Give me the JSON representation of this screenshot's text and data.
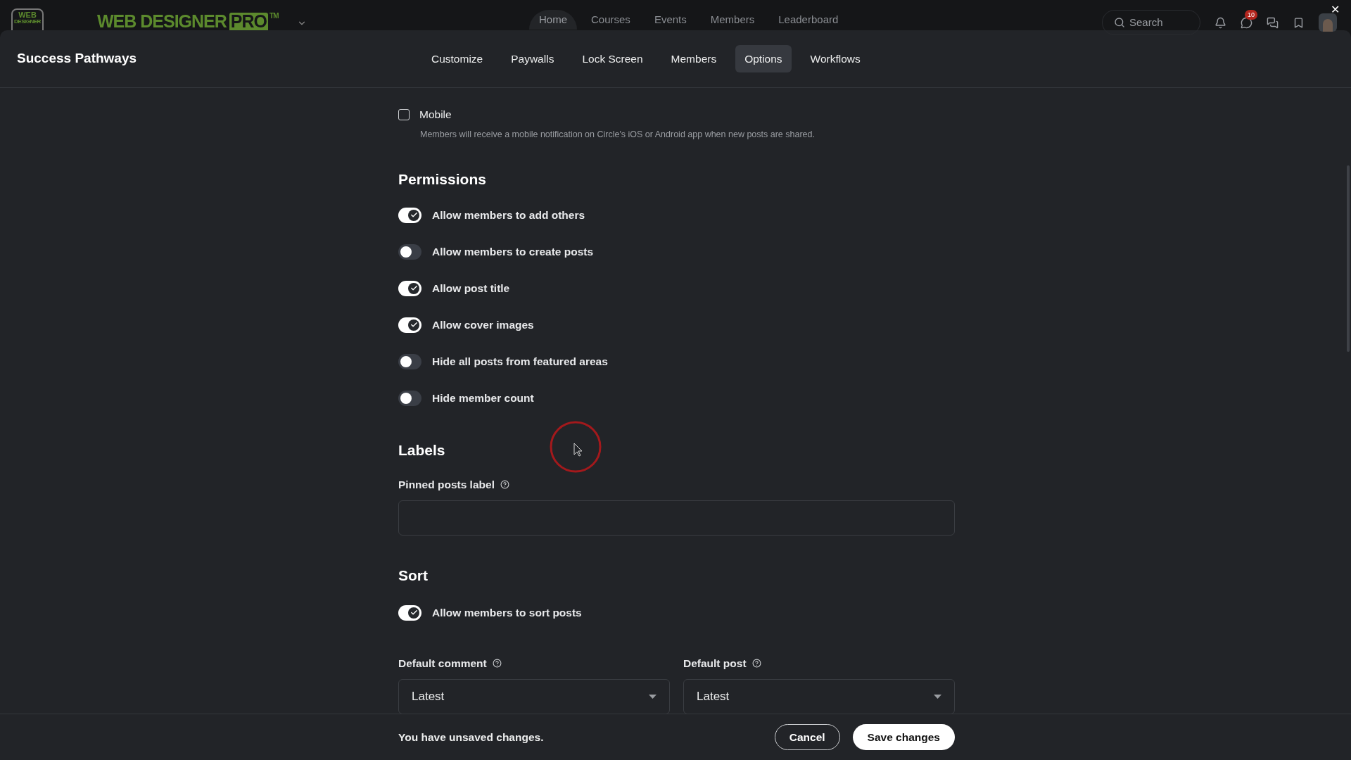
{
  "topbar": {
    "logo_badge": [
      "WEB",
      "DESIGNER"
    ],
    "brand": {
      "name": "WEB DESIGNER",
      "highlight": "PRO",
      "mark": "TM"
    },
    "nav": [
      {
        "label": "Home",
        "selected": true
      },
      {
        "label": "Courses",
        "selected": false
      },
      {
        "label": "Events",
        "selected": false
      },
      {
        "label": "Members",
        "selected": false
      },
      {
        "label": "Leaderboard",
        "selected": false
      }
    ],
    "search": {
      "placeholder": "Search"
    },
    "chat_badge": "10",
    "close": "✕"
  },
  "modal": {
    "title": "Success Pathways",
    "tabs": [
      {
        "label": "Customize",
        "selected": false
      },
      {
        "label": "Paywalls",
        "selected": false
      },
      {
        "label": "Lock Screen",
        "selected": false
      },
      {
        "label": "Members",
        "selected": false
      },
      {
        "label": "Options",
        "selected": true
      },
      {
        "label": "Workflows",
        "selected": false
      }
    ],
    "mobile": {
      "label": "Mobile",
      "checked": false,
      "description": "Members will receive a mobile notification on Circle's iOS or Android app when new posts are shared."
    },
    "permissions": {
      "heading": "Permissions",
      "toggles": [
        {
          "label": "Allow members to add others",
          "on": true
        },
        {
          "label": "Allow members to create posts",
          "on": false
        },
        {
          "label": "Allow post title",
          "on": true
        },
        {
          "label": "Allow cover images",
          "on": true
        },
        {
          "label": "Hide all posts from featured areas",
          "on": false
        },
        {
          "label": "Hide member count",
          "on": false
        }
      ]
    },
    "labels": {
      "heading": "Labels",
      "field_label": "Pinned posts label"
    },
    "sort": {
      "heading": "Sort",
      "toggles": [
        {
          "label": "Allow members to sort posts",
          "on": true
        }
      ],
      "selects": [
        {
          "label": "Default comment",
          "value": "Latest"
        },
        {
          "label": "Default post",
          "value": "Latest"
        }
      ]
    },
    "footer": {
      "message": "You have unsaved changes.",
      "buttons": [
        {
          "label": "Cancel",
          "kind": "secondary"
        },
        {
          "label": "Save changes",
          "kind": "primary"
        }
      ]
    }
  }
}
